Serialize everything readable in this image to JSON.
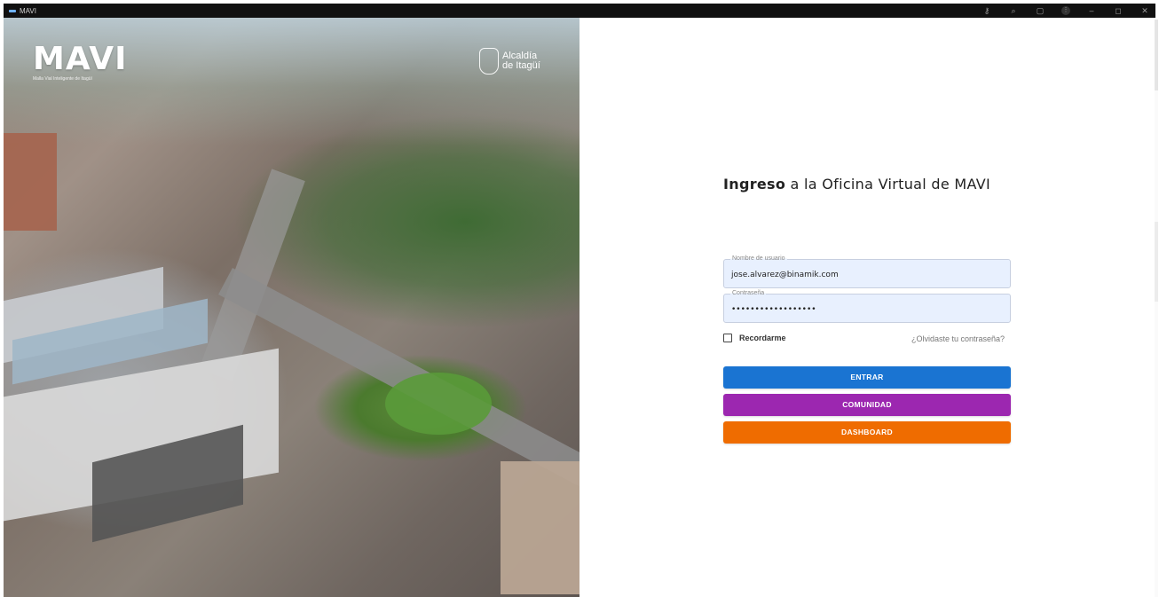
{
  "window": {
    "title": "MAVI",
    "controls": [
      "key-icon",
      "zoom-icon",
      "extensions-icon",
      "menu-icon",
      "minimize-icon",
      "restore-icon",
      "close-icon"
    ]
  },
  "hero": {
    "brand": "MAVI",
    "tagline": "Malla Vial Inteligente de Itagüí",
    "partner_line1": "Alcaldía",
    "partner_line2": "de Itagüí"
  },
  "login": {
    "heading_strong": "Ingreso",
    "heading_rest": " a la Oficina Virtual de MAVI",
    "username_label": "Nombre de usuario",
    "username_value": "jose.alvarez@binamik.com",
    "password_label": "Contraseña",
    "password_value": "••••••••••••••••••",
    "remember_label": "Recordarme",
    "forgot_link": "¿Olvidaste tu contraseña?",
    "buttons": {
      "entrar": "ENTRAR",
      "comunidad": "COMUNIDAD",
      "dashboard": "DASHBOARD"
    }
  },
  "colors": {
    "entrar": "#1a74d2",
    "comunidad": "#9c27b0",
    "dashboard": "#ef6c00",
    "field_bg": "#e8f0fe"
  }
}
